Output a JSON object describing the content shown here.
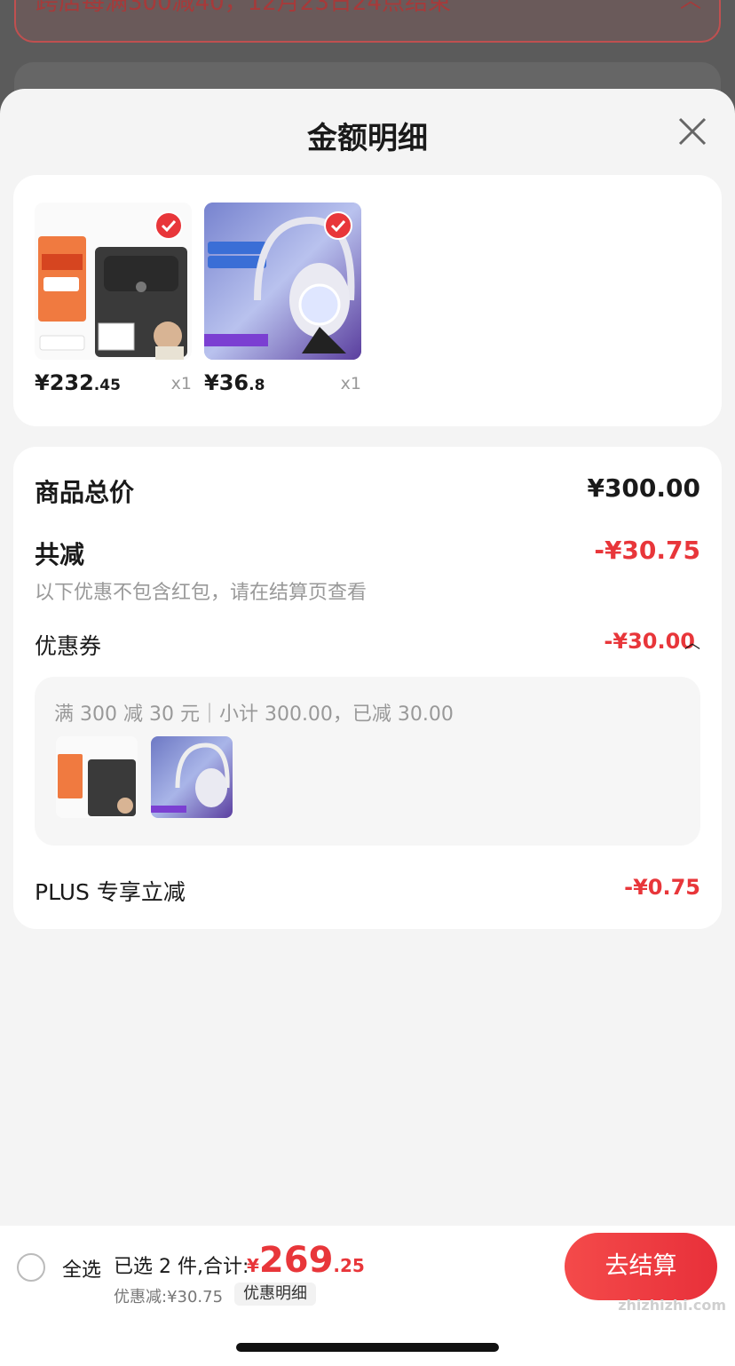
{
  "background": {
    "banner_text": "跨店每满300减40，12月23日24点结束"
  },
  "sheet": {
    "title": "金额明细"
  },
  "products": [
    {
      "price_int": "¥232",
      "price_dec": ".45",
      "qty": "x1",
      "image": "earbuds-product-image"
    },
    {
      "price_int": "¥36",
      "price_dec": ".8",
      "qty": "x1",
      "image": "headset-product-image"
    }
  ],
  "detail": {
    "total_label": "商品总价",
    "total_value": "¥300.00",
    "reduce_label": "共减",
    "reduce_value": "-¥30.75",
    "note": "以下优惠不包含红包，请在结算页查看",
    "coupon_label": "优惠券",
    "coupon_value": "-¥30.00",
    "coupon_rule": "满 300 减 30 元｜小计 300.00，已减 30.00",
    "plus_label": "PLUS 专享立减",
    "plus_value": "-¥0.75"
  },
  "bottom": {
    "select_all": "全选",
    "selected_text": "已选 2 件,合计:",
    "total_yen": "¥",
    "total_int": "269",
    "total_dec": ".25",
    "discount_text": "优惠减:¥30.75",
    "detail_button": "优惠明细",
    "checkout_button": "去结算",
    "watermark": "zhizhizhi.com"
  },
  "colors": {
    "accent": "#e8363a",
    "muted_text": "#999999",
    "sheet_bg": "#f4f4f4"
  }
}
